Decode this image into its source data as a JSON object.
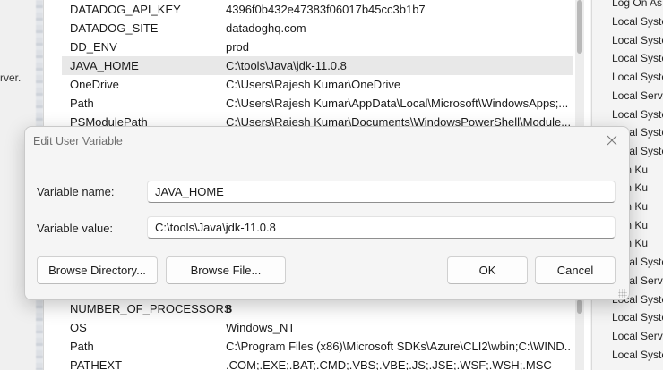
{
  "parent_window": {
    "fragment": "rver."
  },
  "user_variables": [
    {
      "name": "DATADOG_API_KEY",
      "value": "4396f0b432e47383f06017b45cc3b1b7"
    },
    {
      "name": "DATADOG_SITE",
      "value": "datadoghq.com"
    },
    {
      "name": "DD_ENV",
      "value": "prod"
    },
    {
      "name": "JAVA_HOME",
      "value": "C:\\tools\\Java\\jdk-11.0.8",
      "selected": true
    },
    {
      "name": "OneDrive",
      "value": "C:\\Users\\Rajesh Kumar\\OneDrive"
    },
    {
      "name": "Path",
      "value": "C:\\Users\\Rajesh Kumar\\AppData\\Local\\Microsoft\\WindowsApps;..."
    },
    {
      "name": "PSModulePath",
      "value": "C:\\Users\\Rajesh Kumar\\Documents\\WindowsPowerShell\\Module..."
    }
  ],
  "system_variables": [
    {
      "name": "NUMBER_OF_PROCESSORS",
      "value": "8"
    },
    {
      "name": "OS",
      "value": "Windows_NT"
    },
    {
      "name": "Path",
      "value": "C:\\Program Files (x86)\\Microsoft SDKs\\Azure\\CLI2\\wbin;C:\\WIND..."
    },
    {
      "name": "PATHEXT",
      "value": ".COM;.EXE;.BAT;.CMD;.VBS;.VBE;.JS;.JSE;.WSF;.WSH;.MSC"
    }
  ],
  "services_column": {
    "header": "Log On As",
    "values": [
      "Local Syste",
      "Local Syste",
      "Local Syste",
      "Local Syste",
      "Local Servi",
      "Local Syste",
      "Local Syste",
      "Local Syste",
      "jesh Ku",
      "jesh Ku",
      "jesh Ku",
      "jesh Ku",
      "jesh Ku",
      "Local Syste",
      "Local Servi",
      "Local Syste",
      "Local Syste",
      "Local Servi",
      "Local Syste"
    ]
  },
  "dialog": {
    "title": "Edit User Variable",
    "name_label": "Variable name:",
    "name_value": "JAVA_HOME",
    "value_label": "Variable value:",
    "value_value": "C:\\tools\\Java\\jdk-11.0.8",
    "browse_directory_label": "Browse Directory...",
    "browse_file_label": "Browse File...",
    "ok_label": "OK",
    "cancel_label": "Cancel",
    "close_icon": "close-icon"
  }
}
